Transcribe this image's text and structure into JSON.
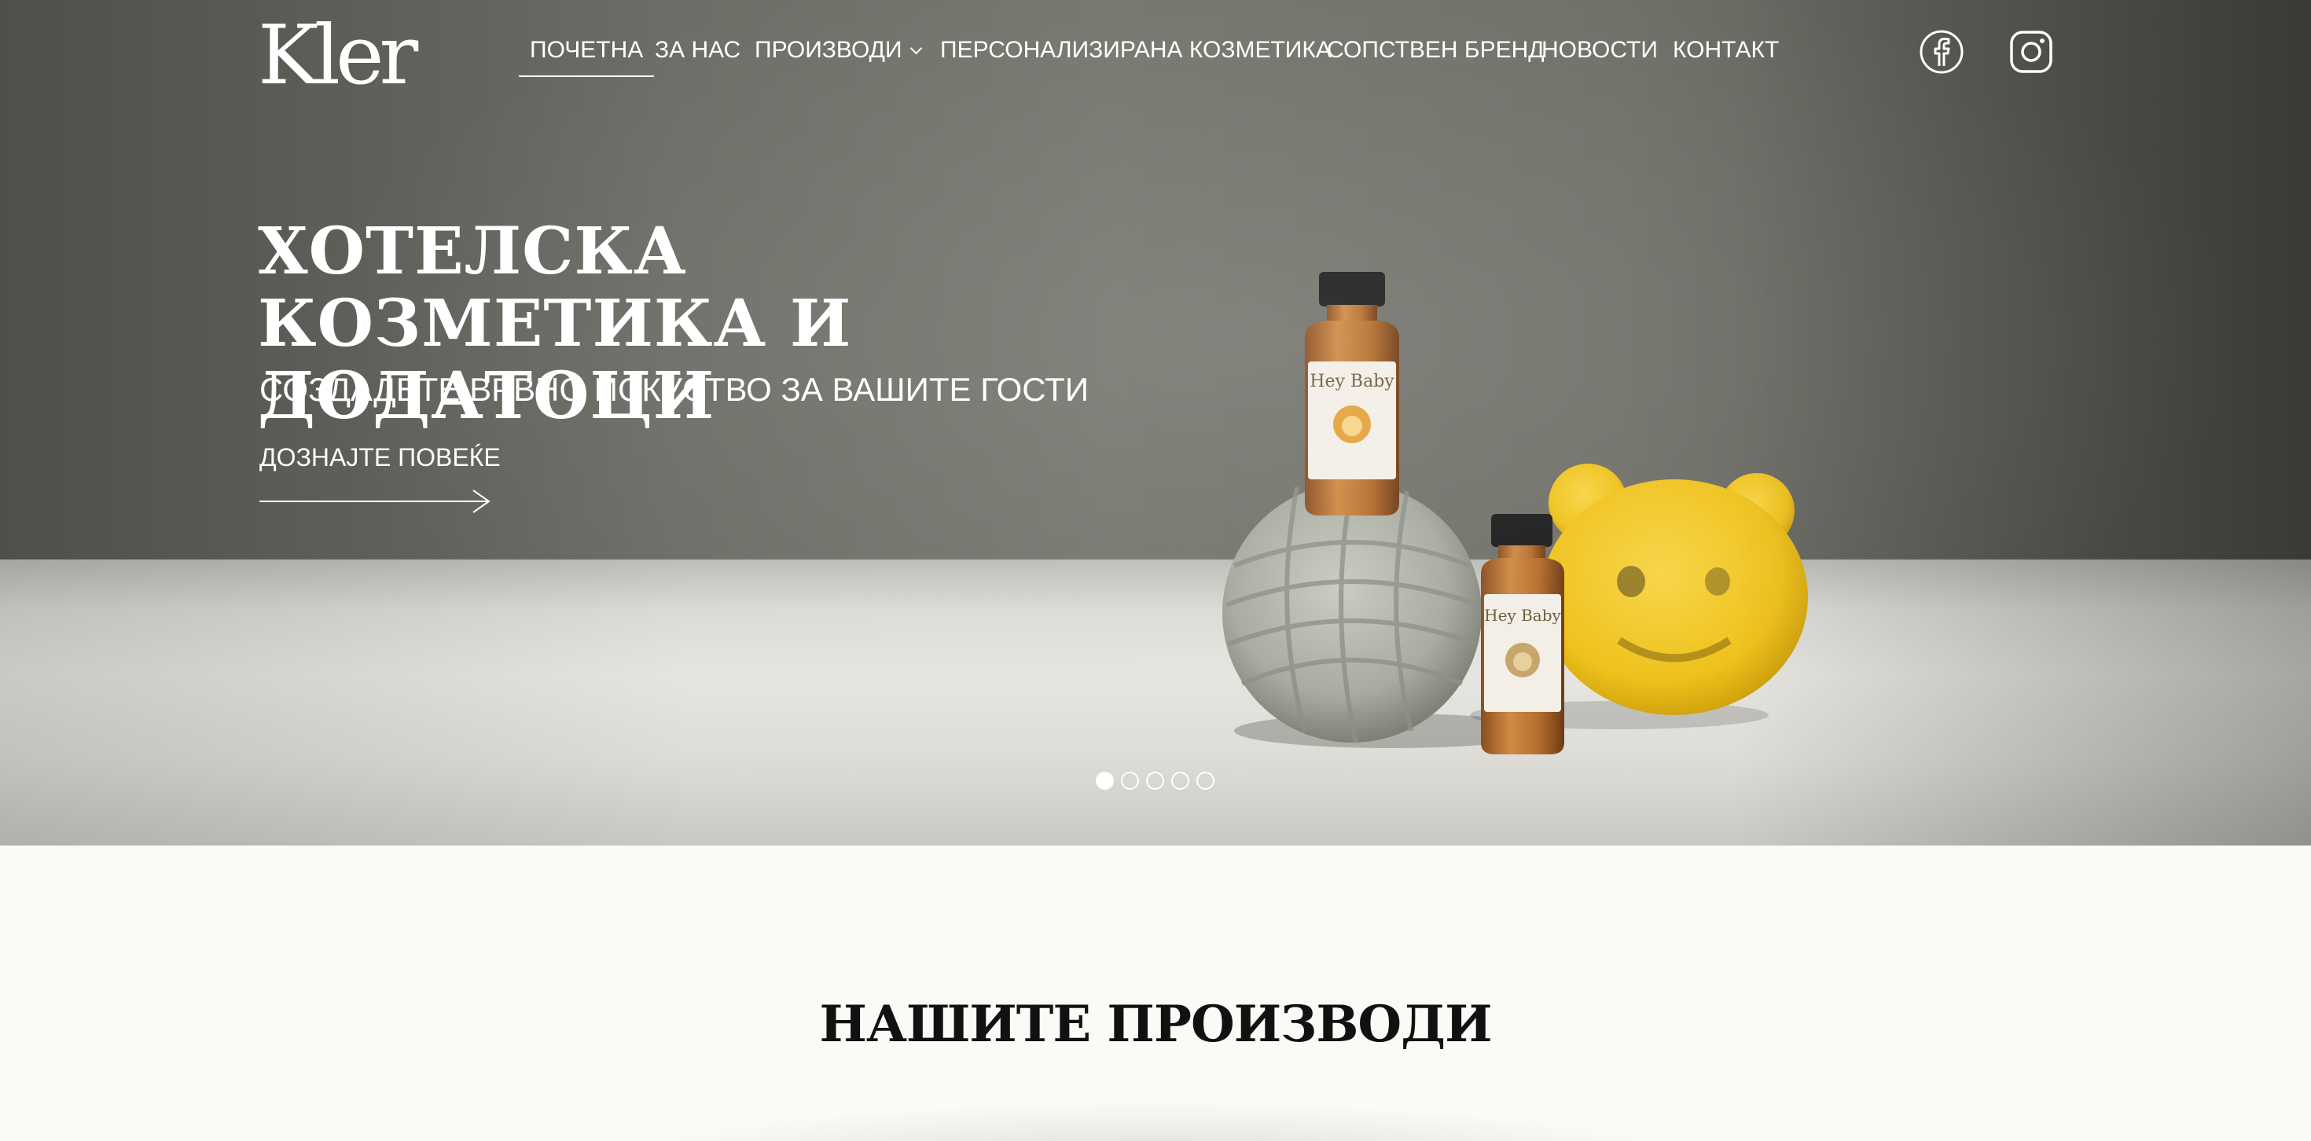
{
  "brand": {
    "logo_text": "Kler"
  },
  "nav": {
    "items": [
      {
        "label": "ПОЧЕТНА",
        "active": true
      },
      {
        "label": "ЗА НАС"
      },
      {
        "label": "ПРОИЗВОДИ",
        "has_dropdown": true
      },
      {
        "label": "ПЕРСОНАЛИЗИРАНА КОЗМЕТИКА"
      },
      {
        "label": "СОПСТВЕН БРЕНД"
      },
      {
        "label": "НОВОСТИ"
      },
      {
        "label": "КОНТАКТ"
      }
    ]
  },
  "social": {
    "facebook_icon": "facebook-icon",
    "instagram_icon": "instagram-icon"
  },
  "hero": {
    "title": "ХОТЕЛСКА КОЗМЕТИКА И ДОДАТОЦИ",
    "subtitle": "СОЗДАДЕТЕ ВРВНО ИСКУСТВО ЗА ВАШИТЕ ГОСТИ",
    "cta_label": "ДОЗНАЈТЕ ПОВЕЌЕ",
    "bottle_brand": "Hey Baby",
    "slider": {
      "total": 5,
      "active_index": 1
    }
  },
  "section": {
    "products_title": "НАШИТЕ ПРОИЗВОДИ"
  },
  "colors": {
    "hero_text": "#ffffff",
    "page_bg": "#fbfaf6",
    "heading": "#111111",
    "sponge": "#f2c21b"
  }
}
